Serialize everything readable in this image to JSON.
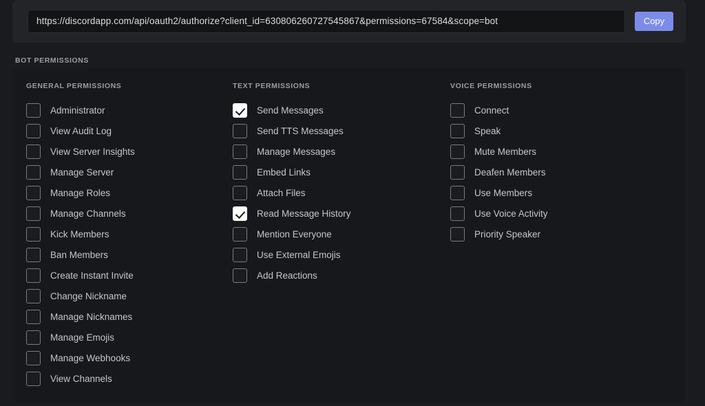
{
  "oauth": {
    "url": "https://discordapp.com/api/oauth2/authorize?client_id=630806260727545867&permissions=67584&scope=bot",
    "copy_label": "Copy"
  },
  "section": {
    "title": "BOT PERMISSIONS"
  },
  "colors": {
    "page_background": "#1a1b1e",
    "card_background": "#232428",
    "panel_background": "#17181b",
    "input_background": "#131416",
    "accent_blurple": "#7c8cea",
    "label_text": "#c4c6c9",
    "header_text": "#9b9da1",
    "checkbox_border": "#787b80",
    "checkbox_checked_background": "#ffffff"
  },
  "columns": [
    {
      "key": "general",
      "title": "GENERAL PERMISSIONS",
      "items": [
        {
          "label": "Administrator",
          "checked": false
        },
        {
          "label": "View Audit Log",
          "checked": false
        },
        {
          "label": "View Server Insights",
          "checked": false
        },
        {
          "label": "Manage Server",
          "checked": false
        },
        {
          "label": "Manage Roles",
          "checked": false
        },
        {
          "label": "Manage Channels",
          "checked": false
        },
        {
          "label": "Kick Members",
          "checked": false
        },
        {
          "label": "Ban Members",
          "checked": false
        },
        {
          "label": "Create Instant Invite",
          "checked": false
        },
        {
          "label": "Change Nickname",
          "checked": false
        },
        {
          "label": "Manage Nicknames",
          "checked": false
        },
        {
          "label": "Manage Emojis",
          "checked": false
        },
        {
          "label": "Manage Webhooks",
          "checked": false
        },
        {
          "label": "View Channels",
          "checked": false
        }
      ]
    },
    {
      "key": "text",
      "title": "TEXT PERMISSIONS",
      "items": [
        {
          "label": "Send Messages",
          "checked": true
        },
        {
          "label": "Send TTS Messages",
          "checked": false
        },
        {
          "label": "Manage Messages",
          "checked": false
        },
        {
          "label": "Embed Links",
          "checked": false
        },
        {
          "label": "Attach Files",
          "checked": false
        },
        {
          "label": "Read Message History",
          "checked": true
        },
        {
          "label": "Mention Everyone",
          "checked": false
        },
        {
          "label": "Use External Emojis",
          "checked": false
        },
        {
          "label": "Add Reactions",
          "checked": false
        }
      ]
    },
    {
      "key": "voice",
      "title": "VOICE PERMISSIONS",
      "items": [
        {
          "label": "Connect",
          "checked": false
        },
        {
          "label": "Speak",
          "checked": false
        },
        {
          "label": "Mute Members",
          "checked": false
        },
        {
          "label": "Deafen Members",
          "checked": false
        },
        {
          "label": "Use Members",
          "checked": false
        },
        {
          "label": "Use Voice Activity",
          "checked": false
        },
        {
          "label": "Priority Speaker",
          "checked": false
        }
      ]
    }
  ]
}
